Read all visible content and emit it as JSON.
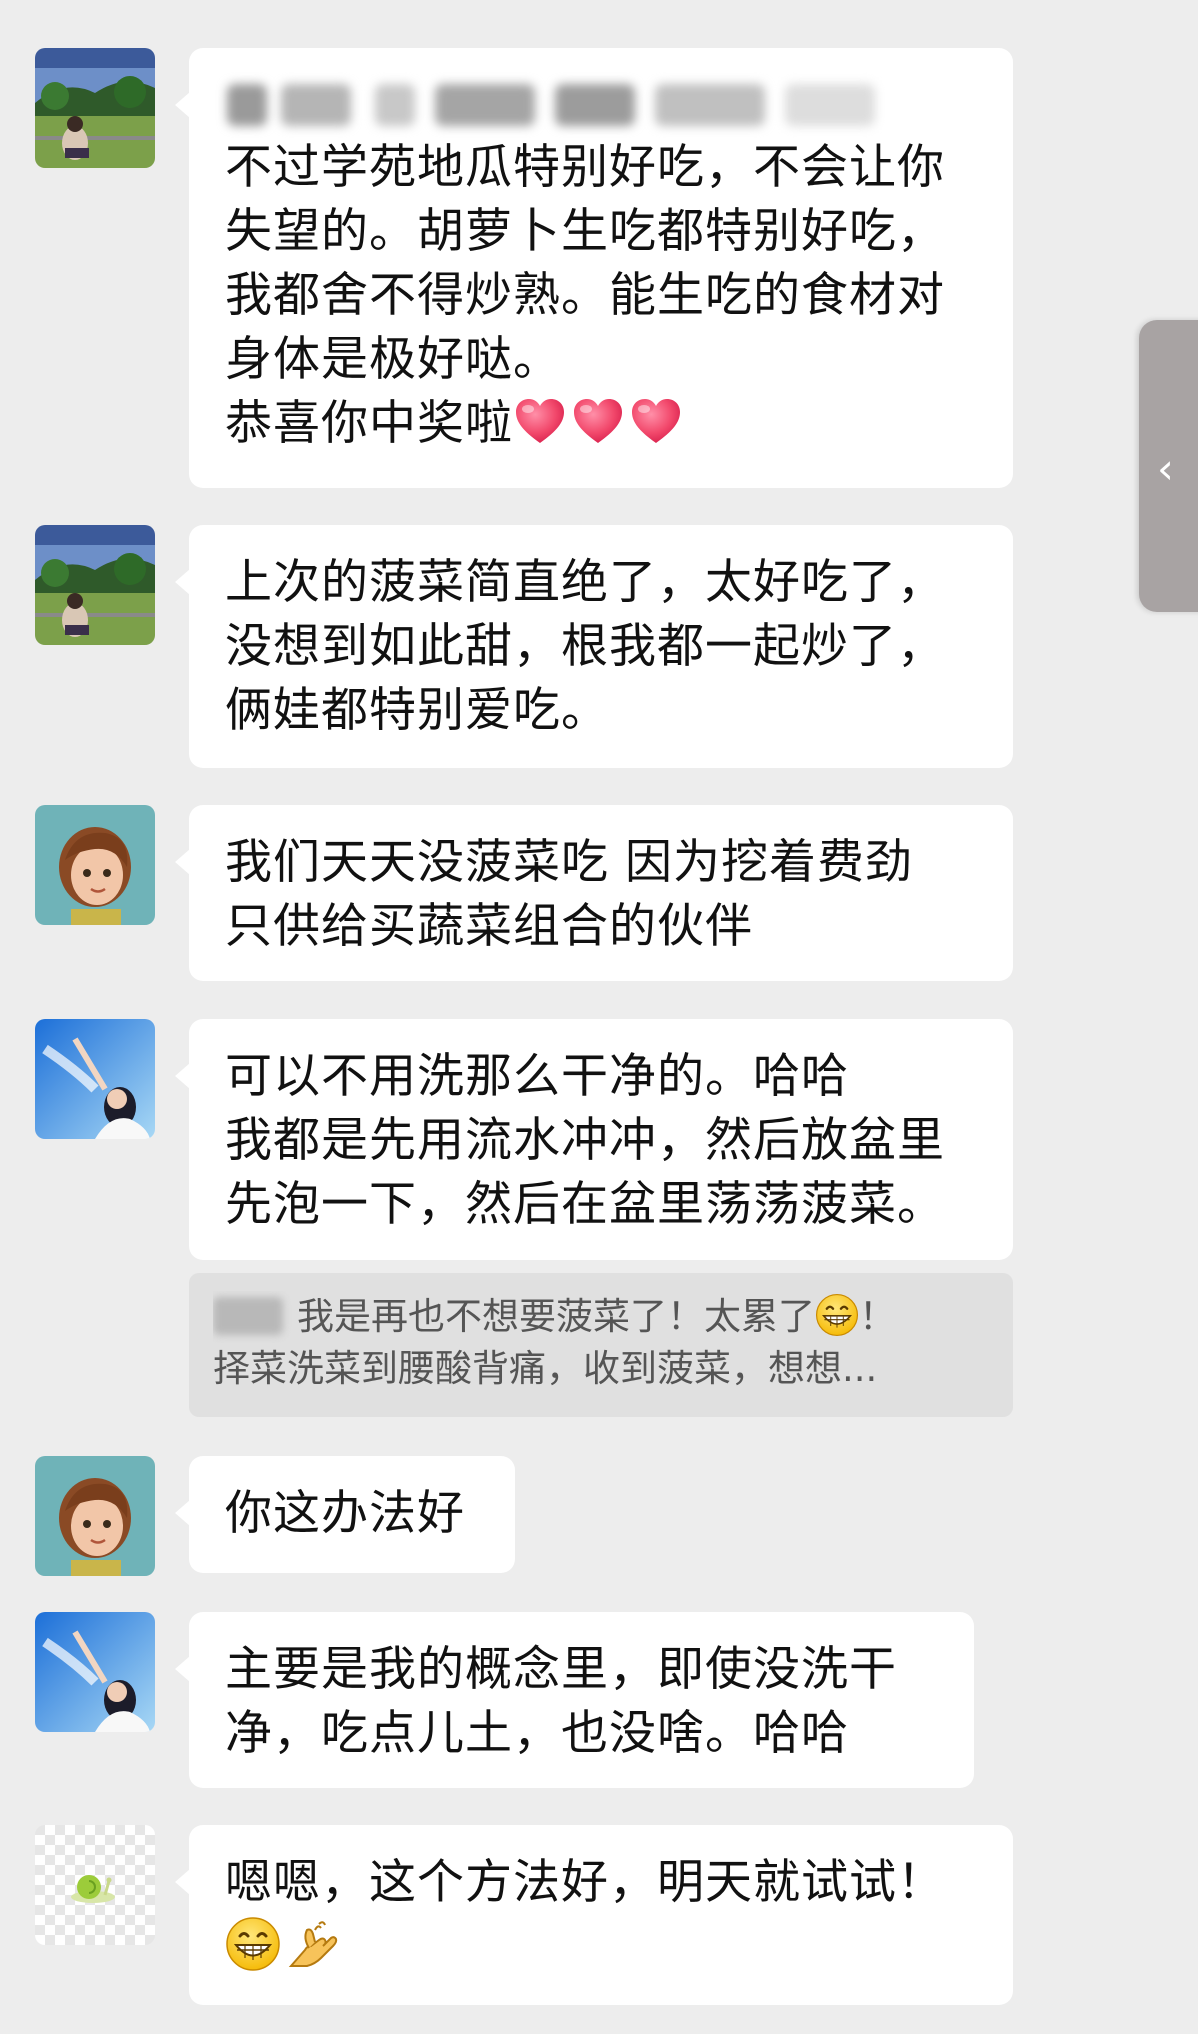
{
  "messages": [
    {
      "avatar": "avatar-landscape-person",
      "lines": [
        "不过学苑地瓜特别好吃，不会让你",
        "失望的。胡萝卜生吃都特别好吃，",
        "我都舍不得炒熟。能生吃的食材对",
        "身体是极好哒。",
        "恭喜你中奖啦"
      ]
    },
    {
      "avatar": "avatar-landscape-person",
      "lines": [
        "上次的菠菜简直绝了，太好吃了，",
        "没想到如此甜，根我都一起炒了，",
        "俩娃都特别爱吃。"
      ]
    },
    {
      "avatar": "avatar-cartoon-girl",
      "lines": [
        "我们天天没菠菜吃 因为挖着费劲",
        "只供给买蔬菜组合的伙伴"
      ]
    },
    {
      "avatar": "avatar-sky-girl",
      "lines": [
        "可以不用洗那么干净的。哈哈",
        "我都是先用流水冲冲，然后放盆里",
        "先泡一下，然后在盆里荡荡菠菜。"
      ]
    },
    {
      "avatar": "avatar-cartoon-girl",
      "lines": [
        "你这办法好"
      ]
    },
    {
      "avatar": "avatar-sky-girl",
      "lines": [
        "主要是我的概念里，即使没洗干",
        "净，吃点儿土，也没啥。哈哈"
      ]
    },
    {
      "avatar": "avatar-snail",
      "lines": [
        "嗯嗯，这个方法好，明天就试试！"
      ]
    }
  ],
  "quote": {
    "line1": "我是再也不想要菠菜了！太累了",
    "line1_end": "！",
    "line2": "择菜洗菜到腰酸背痛，收到菠菜，想想..."
  },
  "icons": {
    "heart": "red-heart-icon",
    "grin": "grinning-face-icon",
    "hand": "ok-hand-icon",
    "side_tab": "chevron-left-icon"
  },
  "side_tab": {
    "chevron": "‹"
  }
}
